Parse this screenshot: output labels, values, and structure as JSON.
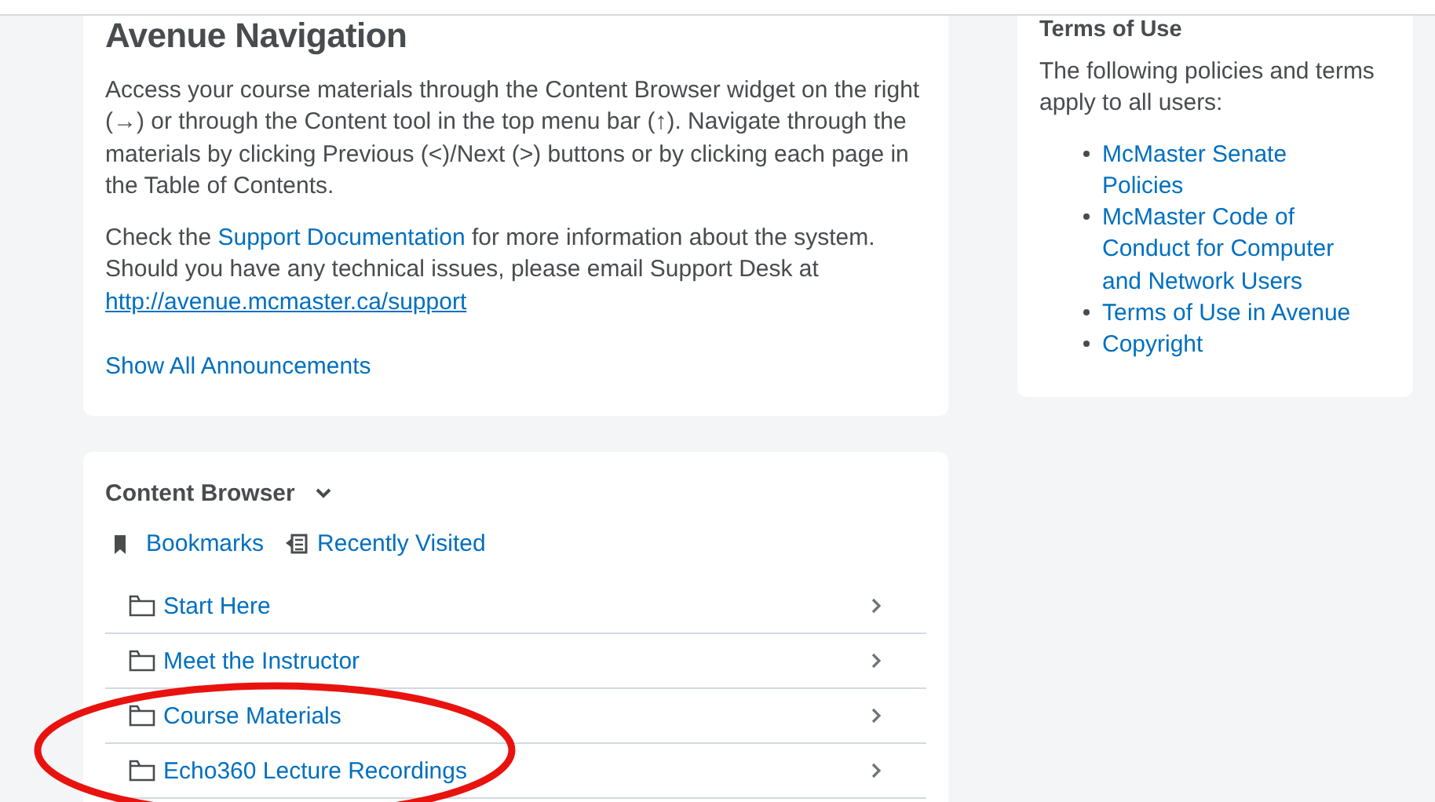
{
  "announcement": {
    "title": "Avenue Navigation",
    "paragraphs": [
      [
        {
          "kind": "text",
          "text": "Access your course materials through the Content Browser widget on the right (→) or through the Content tool in the top menu bar (↑). Navigate through the materials by clicking Previous (<)/Next (>) buttons or by clicking each page in the Table of Contents."
        }
      ],
      [
        {
          "kind": "text",
          "text": "Check the "
        },
        {
          "kind": "link",
          "text": "Support Documentation"
        },
        {
          "kind": "text",
          "text": " for more information about the system. Should you have any technical issues, please email Support Desk at "
        },
        {
          "kind": "url",
          "text": "http://avenue.mcmaster.ca/support"
        }
      ]
    ],
    "footer_link": "Show All Announcements"
  },
  "terms": {
    "title": "Terms of Use",
    "intro": "The following policies and terms apply to all users:",
    "links": [
      "McMaster Senate Policies",
      "McMaster Code of Conduct for Computer and Network Users",
      "Terms of Use in Avenue",
      "Copyright"
    ]
  },
  "content_browser": {
    "title": "Content Browser",
    "tabs": [
      "Bookmarks",
      "Recently Visited"
    ],
    "modules": [
      "Start Here",
      "Meet the Instructor",
      "Course Materials",
      "Echo360 Lecture Recordings"
    ]
  },
  "annotation": {
    "kind": "ellipse",
    "color": "#e8130f"
  }
}
